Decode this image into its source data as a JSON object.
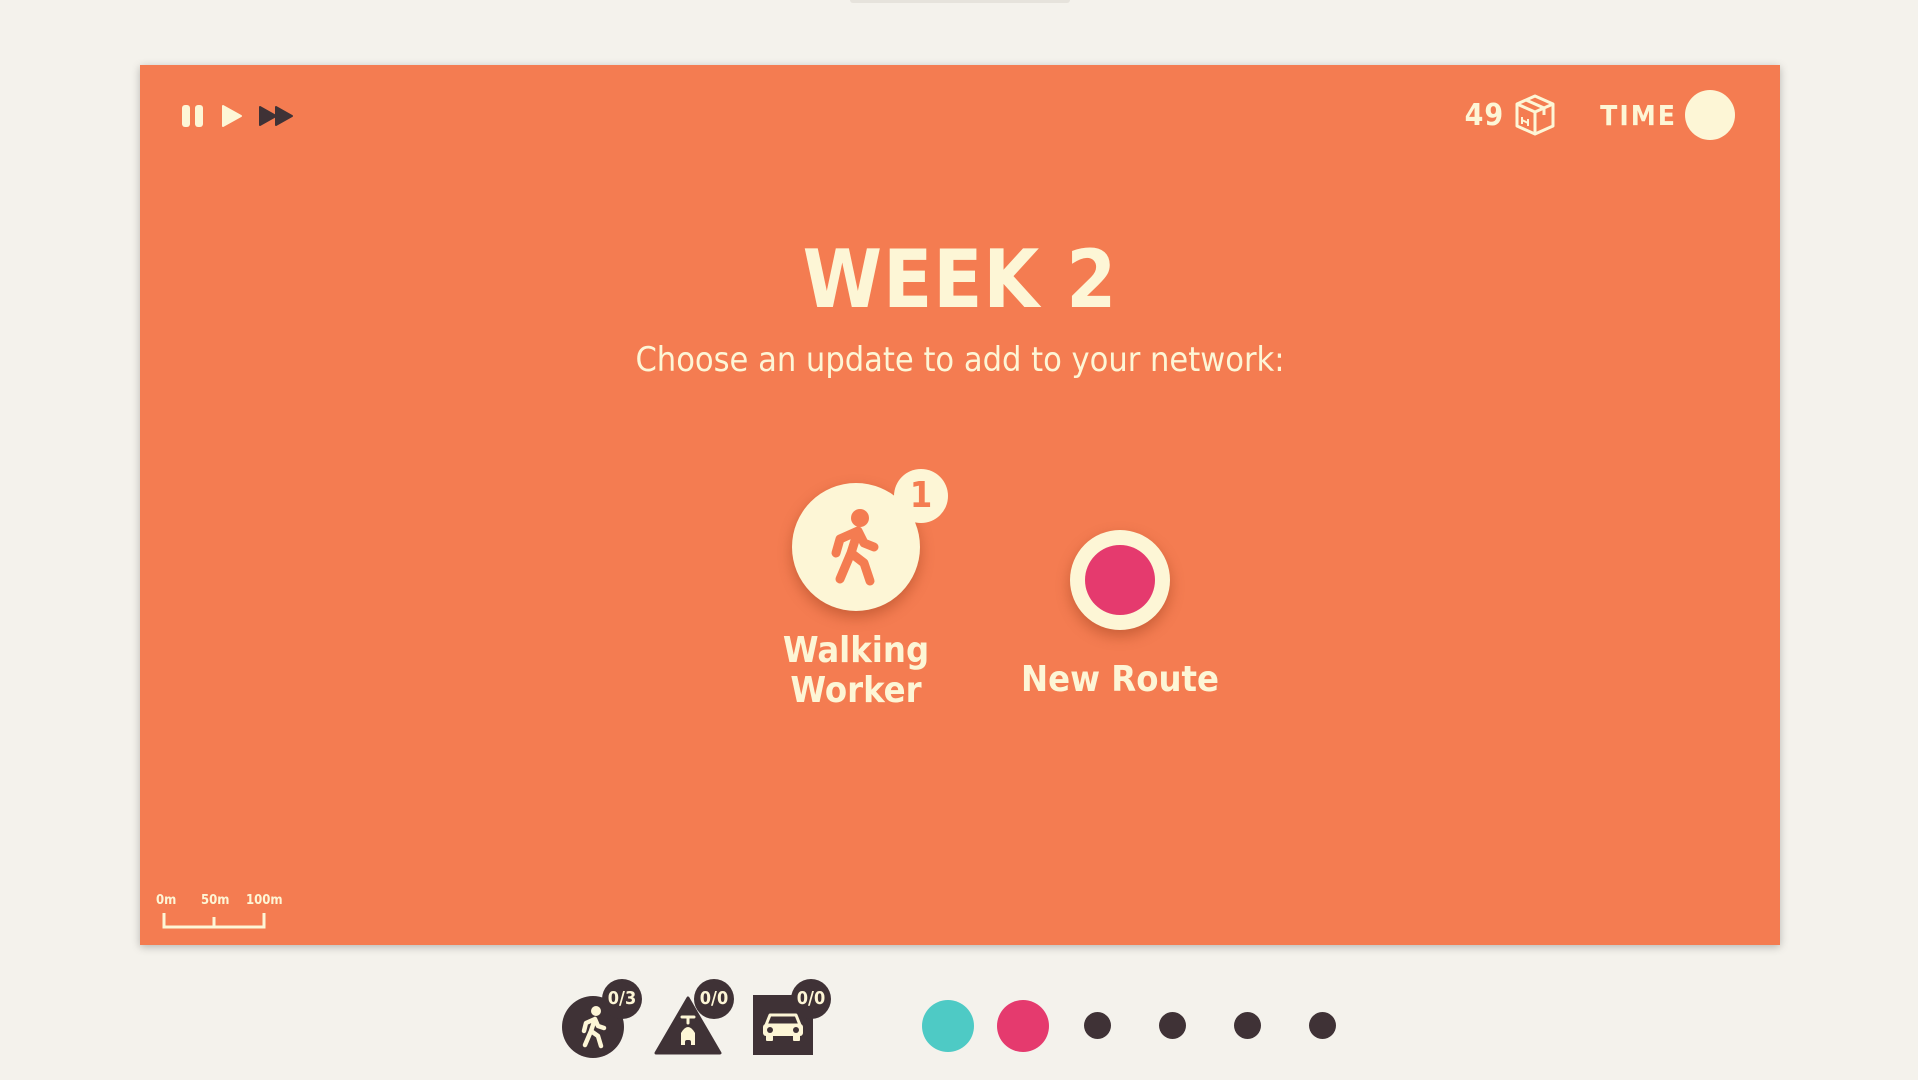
{
  "hud": {
    "controls": [
      "pause",
      "play",
      "fast-forward"
    ],
    "crates": "49",
    "time_label": "TIME"
  },
  "dialog": {
    "title": "WEEK 2",
    "subtitle": "Choose an update to add to your network:",
    "options": [
      {
        "label_line1": "Walking",
        "label_line2": "Worker",
        "badge": "1",
        "icon": "walking-person-icon"
      },
      {
        "label": "New Route",
        "color": "#e53a6e",
        "icon": "route-dot-icon"
      }
    ]
  },
  "scale": {
    "labels": [
      "0m",
      "50m",
      "100m"
    ]
  },
  "toolbar": {
    "vehicles": [
      {
        "count": "0/3",
        "icon": "walking-person-icon"
      },
      {
        "count": "0/0",
        "icon": "scooter-icon"
      },
      {
        "count": "0/0",
        "icon": "car-icon"
      }
    ],
    "lines": [
      {
        "color": "#4ecac5",
        "state": "active"
      },
      {
        "color": "#e53a6e",
        "state": "active"
      },
      {
        "color": "#3f3236",
        "state": "locked"
      },
      {
        "color": "#3f3236",
        "state": "locked"
      },
      {
        "color": "#3f3236",
        "state": "locked"
      },
      {
        "color": "#3f3236",
        "state": "locked"
      }
    ]
  },
  "colors": {
    "board": "#f47c51",
    "cream": "#fdf6d6",
    "dark": "#3f3236",
    "background": "#f4f2ec"
  }
}
